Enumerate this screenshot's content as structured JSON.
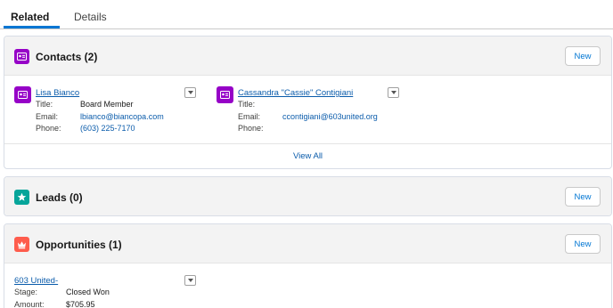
{
  "tabs": [
    {
      "label": "Related"
    },
    {
      "label": "Details"
    }
  ],
  "contacts": {
    "title": "Contacts (2)",
    "new_label": "New",
    "view_all": "View All",
    "icon": "contact-card-icon",
    "icon_color": "#9602c7",
    "records": [
      {
        "name": "Lisa Bianco",
        "fields": [
          {
            "label": "Title:",
            "value": "Board Member"
          },
          {
            "label": "Email:",
            "value": "lbianco@biancopa.com"
          },
          {
            "label": "Phone:",
            "value": "(603) 225-7170"
          }
        ]
      },
      {
        "name": "Cassandra \"Cassie\" Contigiani",
        "fields": [
          {
            "label": "Title:",
            "value": ""
          },
          {
            "label": "Email:",
            "value": "ccontigiani@603united.org"
          },
          {
            "label": "Phone:",
            "value": ""
          }
        ]
      }
    ]
  },
  "leads": {
    "title": "Leads (0)",
    "new_label": "New",
    "icon": "lead-star-icon",
    "icon_color": "#06a59a"
  },
  "opportunities": {
    "title": "Opportunities (1)",
    "new_label": "New",
    "icon": "crown-icon",
    "icon_color": "#fe5c4c",
    "records": [
      {
        "name": "603 United-",
        "fields": [
          {
            "label": "Stage:",
            "value": "Closed Won"
          },
          {
            "label": "Amount:",
            "value": "$705.95"
          }
        ]
      }
    ]
  }
}
